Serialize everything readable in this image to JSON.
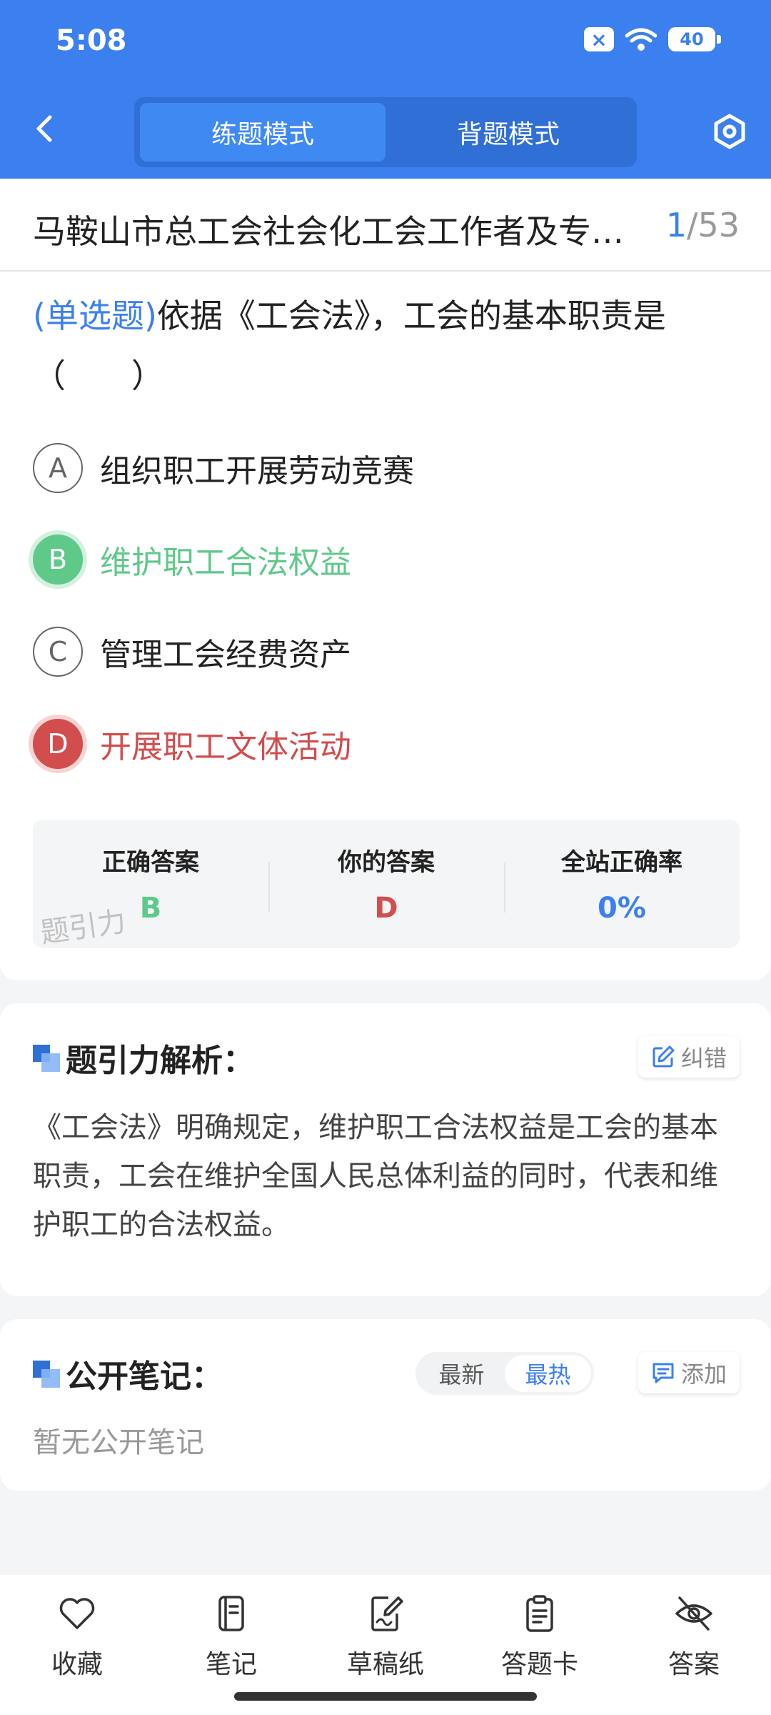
{
  "status": {
    "time": "5:08",
    "battery": "40"
  },
  "header": {
    "modes": [
      "练题模式",
      "背题模式"
    ],
    "active_mode": 0
  },
  "doc": {
    "title": "马鞍山市总工会社会化工会工作者及专…",
    "current": "1",
    "total": "/53"
  },
  "question": {
    "type_label": "(单选题)",
    "text": "依据《工会法》，工会的基本职责是（　　）",
    "options": [
      {
        "letter": "A",
        "text": "组织职工开展劳动竞赛",
        "state": "normal"
      },
      {
        "letter": "B",
        "text": "维护职工合法权益",
        "state": "correct"
      },
      {
        "letter": "C",
        "text": "管理工会经费资产",
        "state": "normal"
      },
      {
        "letter": "D",
        "text": "开展职工文体活动",
        "state": "wrong"
      }
    ]
  },
  "stats": {
    "correct_label": "正确答案",
    "correct_value": "B",
    "yours_label": "你的答案",
    "yours_value": "D",
    "rate_label": "全站正确率",
    "rate_value": "0%",
    "watermark": "题引力"
  },
  "analysis": {
    "title": "题引力解析：",
    "report_label": "纠错",
    "text": "《工会法》明确规定，维护职工合法权益是工会的基本职责，工会在维护全国人民总体利益的同时，代表和维护职工的合法权益。"
  },
  "notes": {
    "title": "公开笔记：",
    "sort": [
      "最新",
      "最热"
    ],
    "active_sort": 1,
    "add_label": "添加",
    "empty": "暂无公开笔记"
  },
  "toolbar": {
    "items": [
      {
        "label": "收藏",
        "icon": "heart-icon"
      },
      {
        "label": "笔记",
        "icon": "notebook-icon"
      },
      {
        "label": "草稿纸",
        "icon": "draft-icon"
      },
      {
        "label": "答题卡",
        "icon": "clipboard-icon"
      },
      {
        "label": "答案",
        "icon": "eye-off-icon"
      }
    ]
  },
  "colors": {
    "primary": "#3b80ee",
    "correct": "#5fc98a",
    "wrong": "#d24d4d"
  }
}
